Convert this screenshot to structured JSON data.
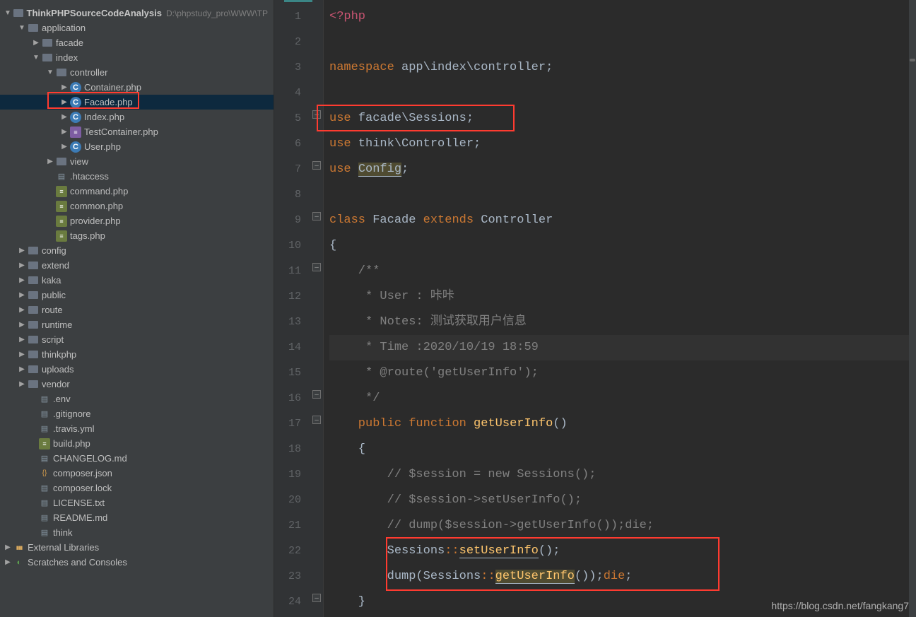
{
  "project": {
    "name": "ThinkPHPSourceCodeAnalysis",
    "path": "D:\\phpstudy_pro\\WWW\\TP"
  },
  "tree": {
    "application": "application",
    "facade": "facade",
    "index": "index",
    "controller": "controller",
    "files": {
      "container": "Container.php",
      "facade": "Facade.php",
      "indexphp": "Index.php",
      "testcontainer": "TestContainer.php",
      "user": "User.php"
    },
    "view": "view",
    "htaccess": ".htaccess",
    "command": "command.php",
    "common": "common.php",
    "provider": "provider.php",
    "tags": "tags.php",
    "config": "config",
    "extend": "extend",
    "kaka": "kaka",
    "public": "public",
    "route": "route",
    "runtime": "runtime",
    "script": "script",
    "thinkphp": "thinkphp",
    "uploads": "uploads",
    "vendor": "vendor",
    "env": ".env",
    "gitignore": ".gitignore",
    "travis": ".travis.yml",
    "build": "build.php",
    "changelog": "CHANGELOG.md",
    "composerjson": "composer.json",
    "composerlock": "composer.lock",
    "license": "LICENSE.txt",
    "readme": "README.md",
    "think": "think"
  },
  "ext": {
    "libs": "External Libraries",
    "scratches": "Scratches and Consoles"
  },
  "code": {
    "l1": "<?php",
    "l3a": "namespace",
    "l3b": " app\\index\\controller;",
    "l5a": "use",
    "l5b": " facade\\Sessions;",
    "l6a": "use",
    "l6b": " think\\Controller;",
    "l7a": "use",
    "l7b": " ",
    "l7c": "Config",
    "l7d": ";",
    "l9a": "class",
    "l9b": " Facade ",
    "l9c": "extends",
    "l9d": " Controller",
    "l10": "{",
    "l11": "    /**",
    "l12": "     * User : 咔咔",
    "l13": "     * Notes: 测试获取用户信息",
    "l14": "     * Time :2020/10/19 18:59",
    "l15": "     * @route('getUserInfo');",
    "l16": "     */",
    "l17a": "    public",
    "l17b": " function",
    "l17c": " getUserInfo",
    "l17d": "()",
    "l18": "    {",
    "l19": "        // $session = new Sessions();",
    "l20": "        // $session->setUserInfo();",
    "l21": "        // dump($session->getUserInfo());die;",
    "l22a": "        Sessions",
    "l22b": "::",
    "l22c": "setUserInfo",
    "l22d": "();",
    "l23a": "        dump(Sessions",
    "l23b": "::",
    "l23c": "getUserInfo",
    "l23d": "());",
    "l23e": "die",
    "l23f": ";",
    "l24": "    }"
  },
  "watermark": "https://blog.csdn.net/fangkang7"
}
